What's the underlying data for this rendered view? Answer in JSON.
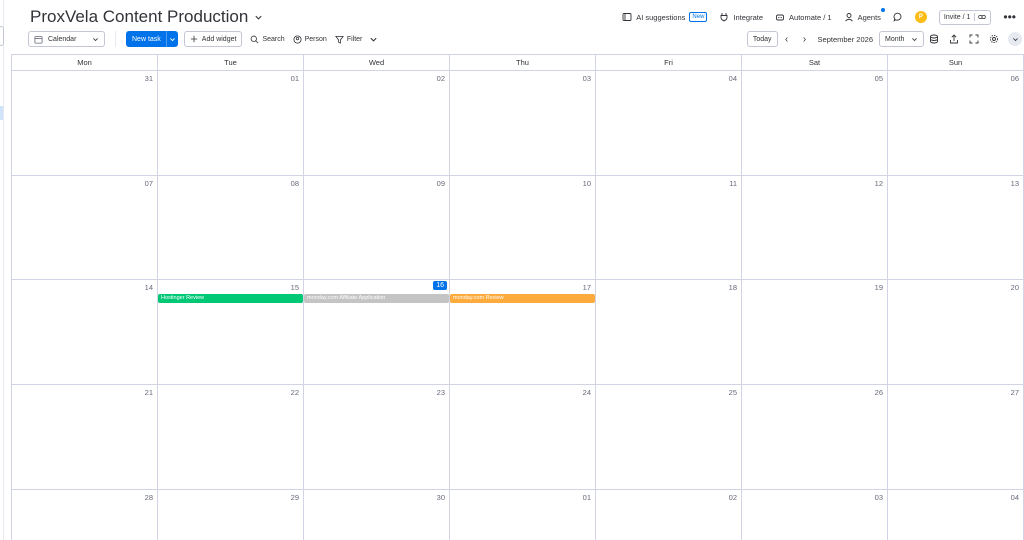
{
  "header": {
    "title": "ProxVela Content Production",
    "actions": {
      "ai_suggestions": "AI suggestions",
      "new_badge": "New",
      "integrate": "Integrate",
      "automate": "Automate / 1",
      "agents": "Agents",
      "avatar_initial": "P",
      "invite": "Invite / 1"
    }
  },
  "toolbar": {
    "view": "Calendar",
    "new_task": "New task",
    "add_widget": "Add widget",
    "search": "Search",
    "person": "Person",
    "filter": "Filter",
    "today": "Today",
    "month_label": "September 2026",
    "range_select": "Month"
  },
  "calendar": {
    "weekdays": [
      "Mon",
      "Tue",
      "Wed",
      "Thu",
      "Fri",
      "Sat",
      "Sun"
    ],
    "today": "16",
    "weeks": [
      [
        "31",
        "01",
        "02",
        "03",
        "04",
        "05",
        "06"
      ],
      [
        "07",
        "08",
        "09",
        "10",
        "11",
        "12",
        "13"
      ],
      [
        "14",
        "15",
        "16",
        "17",
        "18",
        "19",
        "20"
      ],
      [
        "21",
        "22",
        "23",
        "24",
        "25",
        "26",
        "27"
      ],
      [
        "28",
        "29",
        "30",
        "01",
        "02",
        "03",
        "04"
      ]
    ],
    "events": [
      {
        "label": "Hostinger Review",
        "week": 2,
        "day": 1,
        "color": "#00c875"
      },
      {
        "label": "monday.com Affiliate Application",
        "week": 2,
        "day": 2,
        "color": "#c4c4c4"
      },
      {
        "label": "monday.com Review",
        "week": 2,
        "day": 3,
        "color": "#fdab3d"
      }
    ]
  },
  "colors": {
    "accent": "#0073ea",
    "grid": "#d0d4e4"
  }
}
